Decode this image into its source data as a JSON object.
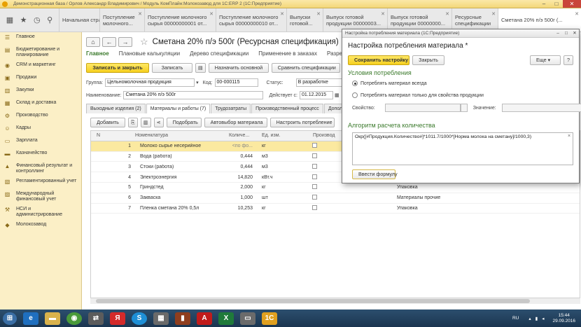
{
  "window": {
    "title": "Демонстрационная база / Орлов Александр Владимирович / Модуль КомПлайн:Молокозавод для 1С:ERP 2  (1С:Предприятие)"
  },
  "open_tabs": [
    {
      "label": "Начальная страница"
    },
    {
      "label": "Поступление молочного..."
    },
    {
      "label": "Поступление молочного сырья 00000000001 от..."
    },
    {
      "label": "Поступление молочного сырья 00000000010 от..."
    },
    {
      "label": "Выпуски готовой..."
    },
    {
      "label": "Выпуск готовой продукции 00000003..."
    },
    {
      "label": "Выпуск готовой продукции 00000000..."
    },
    {
      "label": "Ресурсные спецификации"
    },
    {
      "label": "Сметана 20% п/э 500г (..."
    }
  ],
  "sidebar": {
    "items": [
      {
        "label": "Главное",
        "icon": "menu-icon"
      },
      {
        "label": "Бюджетирование и планирование",
        "icon": "budget-icon"
      },
      {
        "label": "CRM и маркетинг",
        "icon": "crm-icon"
      },
      {
        "label": "Продажи",
        "icon": "sales-icon"
      },
      {
        "label": "Закупки",
        "icon": "purchases-icon"
      },
      {
        "label": "Склад и доставка",
        "icon": "warehouse-icon"
      },
      {
        "label": "Производство",
        "icon": "production-icon"
      },
      {
        "label": "Кадры",
        "icon": "hr-icon"
      },
      {
        "label": "Зарплата",
        "icon": "salary-icon"
      },
      {
        "label": "Казначейство",
        "icon": "treasury-icon"
      },
      {
        "label": "Финансовый результат и контроллинг",
        "icon": "finance-icon"
      },
      {
        "label": "Регламентированный учет",
        "icon": "accounting-icon"
      },
      {
        "label": "Международный финансовый учет",
        "icon": "intl-finance-icon"
      },
      {
        "label": "НСИ и администрирование",
        "icon": "admin-icon"
      },
      {
        "label": "Молокозавод",
        "icon": "dairy-icon"
      }
    ]
  },
  "doc": {
    "title": "Сметана 20% п/э 500г (Ресурсная спецификация)",
    "link_tabs": [
      "Главное",
      "Плановые калькуляции",
      "Дерево спецификации",
      "Применение в заказах",
      "Разреш"
    ],
    "buttons": {
      "save_close": "Записать и закрыть",
      "save": "Записать",
      "set_main": "Назначить основной",
      "compare": "Сравнить спецификации"
    },
    "fields": {
      "group_label": "Группа:",
      "group_value": "Цельномолочная продукция",
      "code_label": "Код:",
      "code_value": "00-000115",
      "status_label": "Статус:",
      "status_value": "В разработке",
      "name_label": "Наименование:",
      "name_value": "Сметана 20% п/э 500г",
      "valid_label": "Действует с:",
      "valid_value": "01.12.2015"
    },
    "form_tabs": [
      "Выходные изделия (2)",
      "Материалы и работы (7)",
      "Трудозатраты",
      "Производственный процесс",
      "Дополните"
    ],
    "grid_buttons": {
      "add": "Добавить",
      "pick": "Подобрать",
      "autopick": "Автовыбор материала",
      "set_consumption": "Настроить потребление"
    },
    "grid": {
      "headers": [
        "N",
        "Номенклатура",
        "Количе...",
        "Ед. изм.",
        "Производ"
      ],
      "rows": [
        {
          "n": "1",
          "name": "Молоко сырье несерийное",
          "qty": "<по фо...",
          "unit": "кг",
          "extra": ""
        },
        {
          "n": "2",
          "name": "Вода (работа)",
          "qty": "0,444",
          "unit": "м3",
          "extra": ""
        },
        {
          "n": "3",
          "name": "Стоки (работа)",
          "qty": "0,444",
          "unit": "м3",
          "extra": ""
        },
        {
          "n": "4",
          "name": "Электроэнергия",
          "qty": "14,820",
          "unit": "кВт.ч",
          "extra": ""
        },
        {
          "n": "5",
          "name": "Гриндстед",
          "qty": "2,000",
          "unit": "кг",
          "extra": "Упаковка"
        },
        {
          "n": "6",
          "name": "Закваска",
          "qty": "1,000",
          "unit": "шт",
          "extra": "Материалы прочие"
        },
        {
          "n": "7",
          "name": "Пленка сметана 20% 0,5л",
          "qty": "10,253",
          "unit": "кг",
          "extra": "Упаковка"
        }
      ]
    }
  },
  "dialog": {
    "window_title": "Настройка потребления материала (1С:Предприятие)",
    "heading": "Настройка потребления материала *",
    "save_btn": "Сохранить настройку",
    "close_btn": "Закрыть",
    "more_btn": "Еще",
    "help_btn": "?",
    "cond_title": "Условия потребления",
    "radio1": "Потреблять материал всегда",
    "radio2": "Потреблять материал только для свойства продукции",
    "prop_label": "Свойство:",
    "value_label": "Значение:",
    "algo_title": "Алгоритм расчета количества",
    "formula": "Окр([#Продукция.Количество#]*1011.7/1000*[Норма молока на сметану]/1000,3)",
    "enter_formula_btn": "Ввести формулу"
  },
  "taskbar": {
    "lang": "RU",
    "time": "15:44",
    "date": "29.09.2016"
  }
}
